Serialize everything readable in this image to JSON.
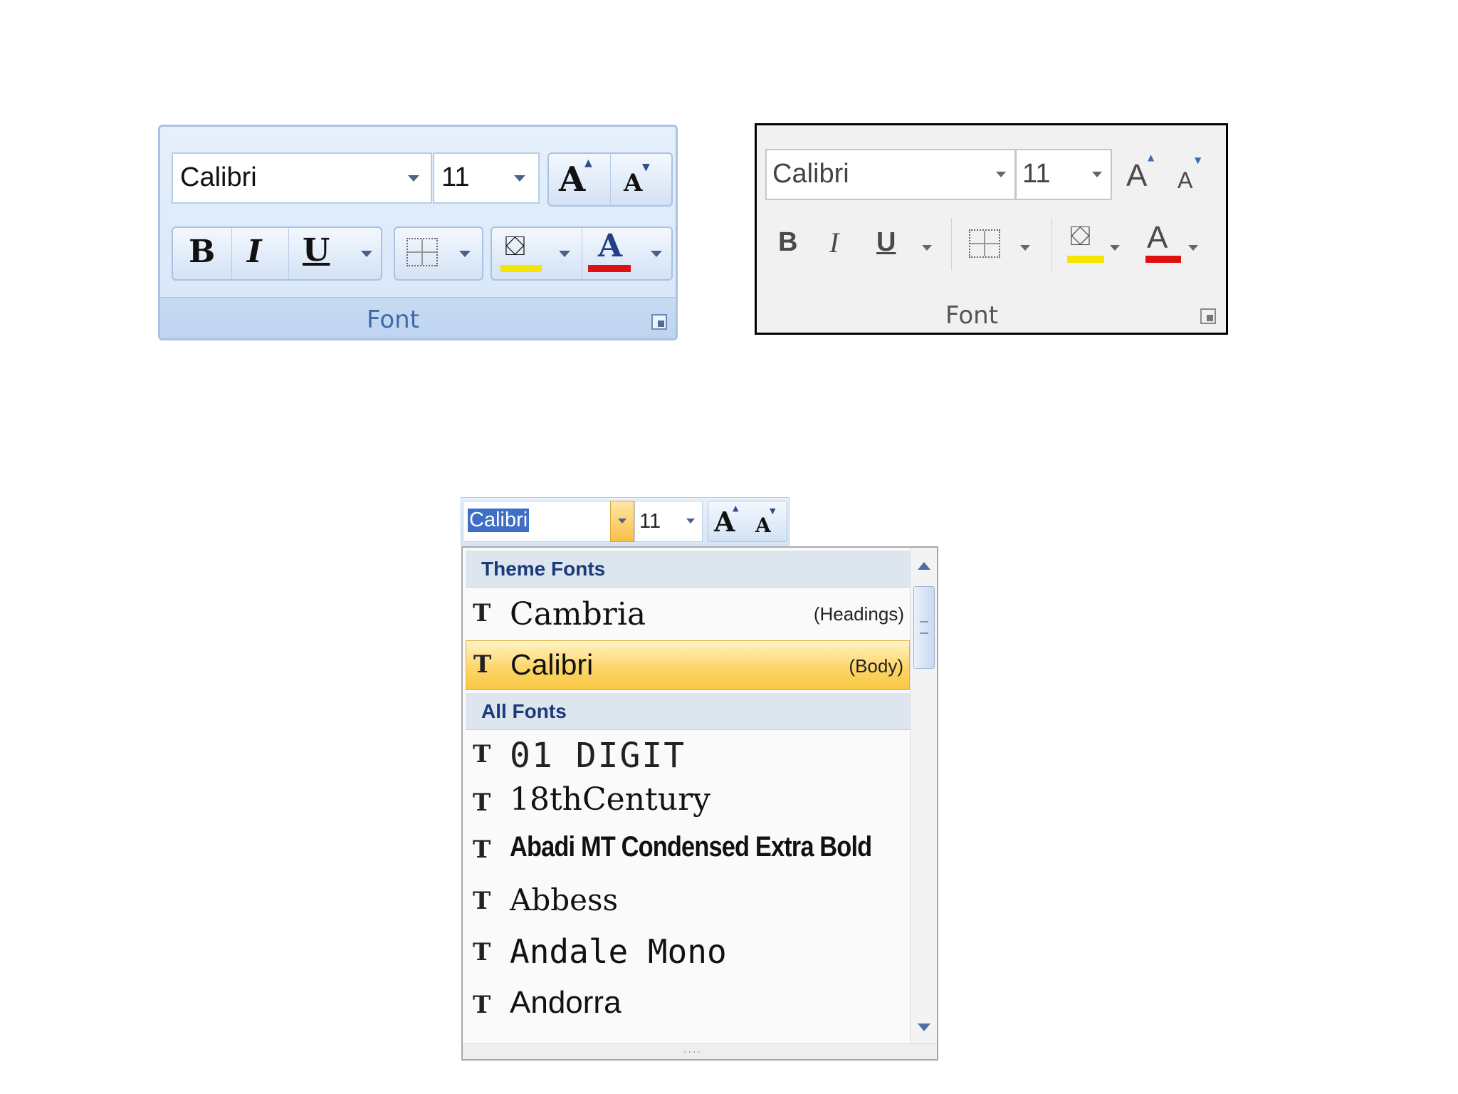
{
  "ribbon_2007": {
    "font_name": "Calibri",
    "font_size": "11",
    "grow_glyph": "A",
    "shrink_glyph": "A",
    "bold_glyph": "B",
    "italic_glyph": "I",
    "underline_glyph": "U",
    "text_color_glyph": "A",
    "group_label": "Font",
    "highlight_color": "#f5e600",
    "font_color": "#e01010"
  },
  "ribbon_flat": {
    "font_name": "Calibri",
    "font_size": "11",
    "grow_glyph": "A",
    "shrink_glyph": "A",
    "bold_glyph": "B",
    "italic_glyph": "I",
    "underline_glyph": "U",
    "text_color_glyph": "A",
    "group_label": "Font",
    "highlight_color": "#f5e600",
    "font_color": "#e01010"
  },
  "font_dropdown": {
    "font_name": "Calibri",
    "font_size": "11",
    "grow_glyph": "A",
    "shrink_glyph": "A",
    "theme_header": "Theme Fonts",
    "all_header": "All Fonts",
    "theme_fonts": [
      {
        "name": "Cambria",
        "note": "(Headings)"
      },
      {
        "name": "Calibri",
        "note": "(Body)",
        "selected": true
      }
    ],
    "all_fonts": [
      {
        "name": "01 DIGIT"
      },
      {
        "name": "18thCentury"
      },
      {
        "name": "Abadi MT Condensed Extra Bold"
      },
      {
        "name": "Abbess"
      },
      {
        "name": "Andale Mono"
      },
      {
        "name": "Andorra"
      }
    ],
    "truetype_glyph": "T",
    "grip_glyph": "....",
    "highlight_color": "#fdd66a"
  }
}
